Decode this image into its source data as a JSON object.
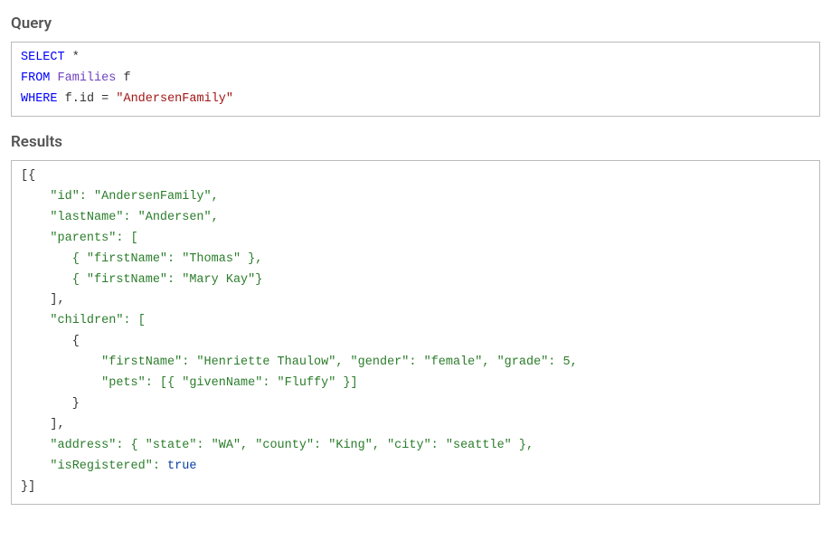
{
  "headings": {
    "query": "Query",
    "results": "Results"
  },
  "query": {
    "select_kw": "SELECT",
    "star": "*",
    "from_kw": "FROM",
    "from_table": "Families",
    "from_alias": "f",
    "where_kw": "WHERE",
    "where_lhs_obj": "f",
    "where_lhs_dot": ".",
    "where_lhs_prop": "id",
    "where_op": "=",
    "where_rhs": "\"AndersenFamily\""
  },
  "results": {
    "open": "[{",
    "line_id": "    \"id\": \"AndersenFamily\",",
    "line_lastName": "    \"lastName\": \"Andersen\",",
    "line_parents_open": "    \"parents\": [",
    "line_parent_0": "       { \"firstName\": \"Thomas\" },",
    "line_parent_1": "       { \"firstName\": \"Mary Kay\"}",
    "line_parents_close": "    ],",
    "line_children_open": "    \"children\": [",
    "line_children_obj_open": "       {",
    "line_child_0a": "           \"firstName\": \"Henriette Thaulow\", \"gender\": \"female\", \"grade\": 5,",
    "line_child_0b": "           \"pets\": [{ \"givenName\": \"Fluffy\" }]",
    "line_children_obj_close": "       }",
    "line_children_close": "    ],",
    "line_address": "    \"address\": { \"state\": \"WA\", \"county\": \"King\", \"city\": \"seattle\" },",
    "line_isRegistered_key": "    \"isRegistered\": ",
    "line_isRegistered_val": "true",
    "close": "}]"
  }
}
